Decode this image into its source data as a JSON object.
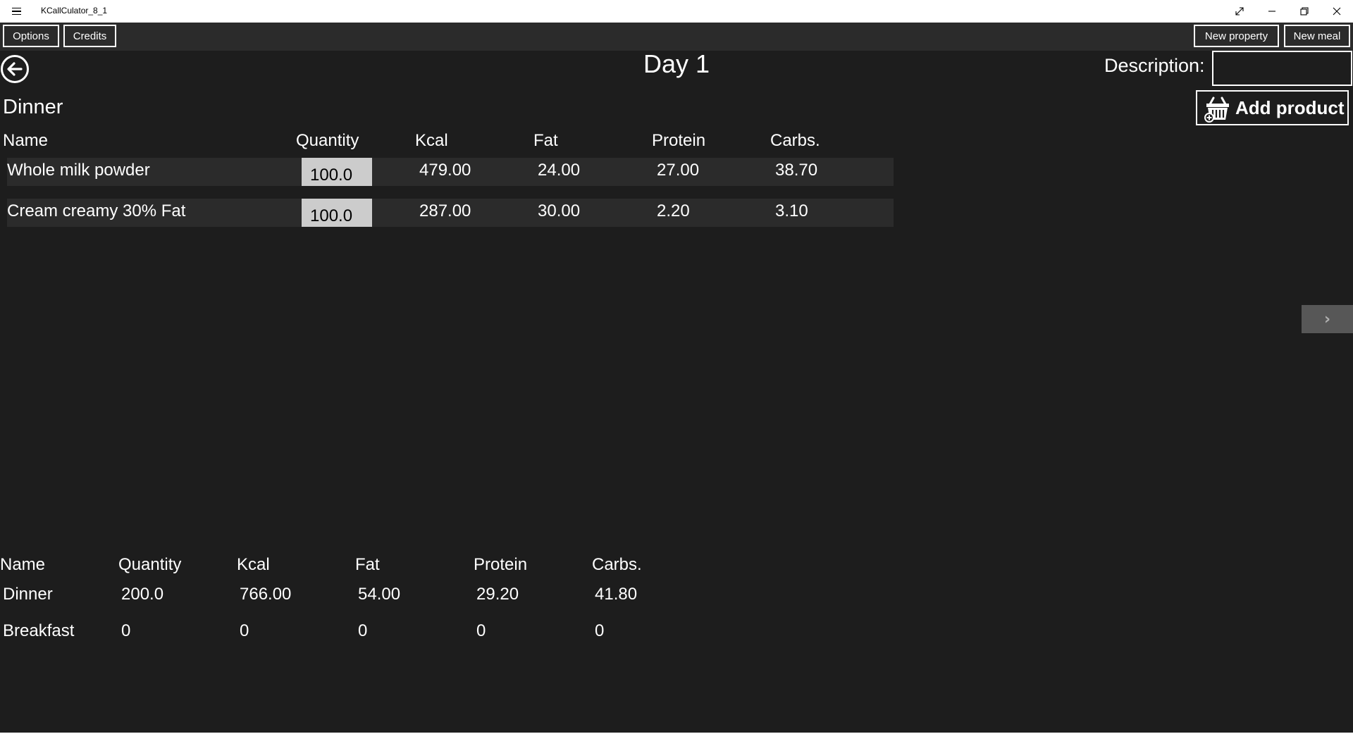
{
  "window": {
    "title": "KCallCulator_8_1",
    "icons": [
      "hamburger-menu-icon",
      "fullscreen-icon",
      "minimize-icon",
      "restore-icon",
      "close-icon"
    ]
  },
  "commandbar": {
    "options_label": "Options",
    "credits_label": "Credits",
    "new_property_label": "New property",
    "new_meal_label": "New meal"
  },
  "header": {
    "day_title": "Day 1",
    "description_label": "Description:",
    "description_value": "",
    "add_product_label": "Add product"
  },
  "meal": {
    "title": "Dinner",
    "columns": [
      "Name",
      "Quantity",
      "Kcal",
      "Fat",
      "Protein",
      "Carbs."
    ],
    "rows": [
      {
        "name": "Whole milk powder",
        "quantity": "100.0",
        "kcal": "479.00",
        "fat": "24.00",
        "protein": "27.00",
        "carbs": "38.70"
      },
      {
        "name": "Cream creamy 30% Fat",
        "quantity": "100.0",
        "kcal": "287.00",
        "fat": "30.00",
        "protein": "2.20",
        "carbs": "3.10"
      }
    ]
  },
  "next_arrow": "›",
  "summary": {
    "columns": [
      "Name",
      "Quantity",
      "Kcal",
      "Fat",
      "Protein",
      "Carbs."
    ],
    "rows": [
      {
        "name": "Dinner",
        "quantity": "200.0",
        "kcal": "766.00",
        "fat": "54.00",
        "protein": "29.20",
        "carbs": "41.80"
      },
      {
        "name": "Breakfast",
        "quantity": "0",
        "kcal": "0",
        "fat": "0",
        "protein": "0",
        "carbs": "0"
      }
    ]
  },
  "colors": {
    "background": "#1d1d1d",
    "row_background": "#2b2b2b",
    "quantity_box": "#cccccc",
    "arrow_button": "#575757"
  }
}
